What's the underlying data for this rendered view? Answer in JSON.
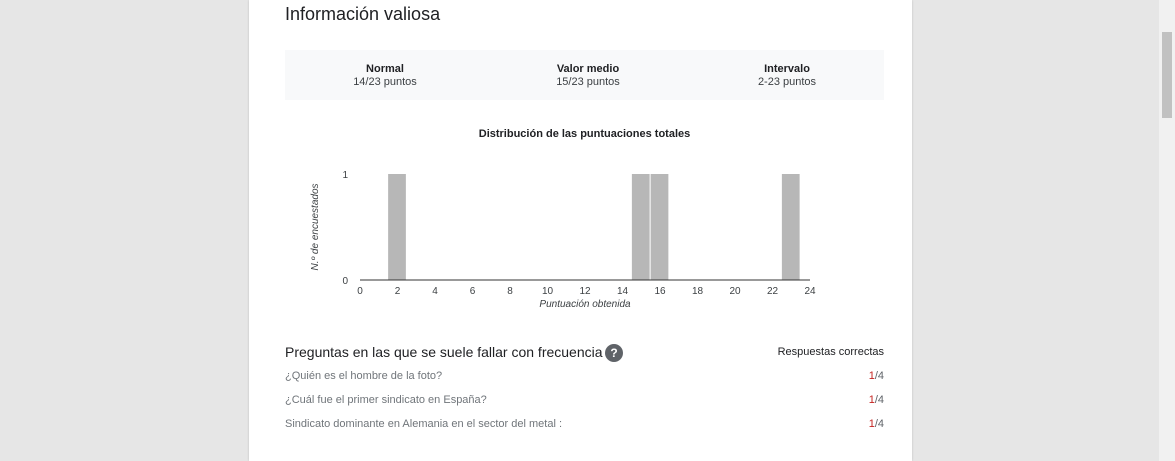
{
  "insights": {
    "title": "Información valiosa",
    "stats": [
      {
        "label": "Normal",
        "value": "14/23 puntos"
      },
      {
        "label": "Valor medio",
        "value": "15/23 puntos"
      },
      {
        "label": "Intervalo",
        "value": "2-23 puntos"
      }
    ]
  },
  "chart_data": {
    "type": "bar",
    "title": "Distribución de las puntuaciones totales",
    "xlabel": "Puntuación obtenida",
    "ylabel": "N.º de encuestados",
    "xlim": [
      0,
      24
    ],
    "ylim": [
      0,
      1
    ],
    "xticks": [
      "0",
      "2",
      "4",
      "6",
      "8",
      "10",
      "12",
      "14",
      "16",
      "18",
      "20",
      "22",
      "24"
    ],
    "yticks": [
      "0",
      "1"
    ],
    "x": [
      2,
      15,
      16,
      23
    ],
    "values": [
      1,
      1,
      1,
      1
    ],
    "bar_color": "#b7b7b7",
    "grid": false
  },
  "missed": {
    "heading": "Preguntas en las que se suele fallar con frecuencia",
    "help_icon": "?",
    "column_header": "Respuestas correctas",
    "questions": [
      {
        "text": "¿Quién es el hombre de la foto?",
        "correct": "1",
        "total": "/4"
      },
      {
        "text": "¿Cuál fue el primer sindicato en España?",
        "correct": "1",
        "total": "/4"
      },
      {
        "text": "Sindicato dominante en Alemania en el sector del metal :",
        "correct": "1",
        "total": "/4"
      }
    ]
  },
  "colors": {
    "accent_wrong": "#c5221f",
    "background": "#e6e6e6"
  }
}
